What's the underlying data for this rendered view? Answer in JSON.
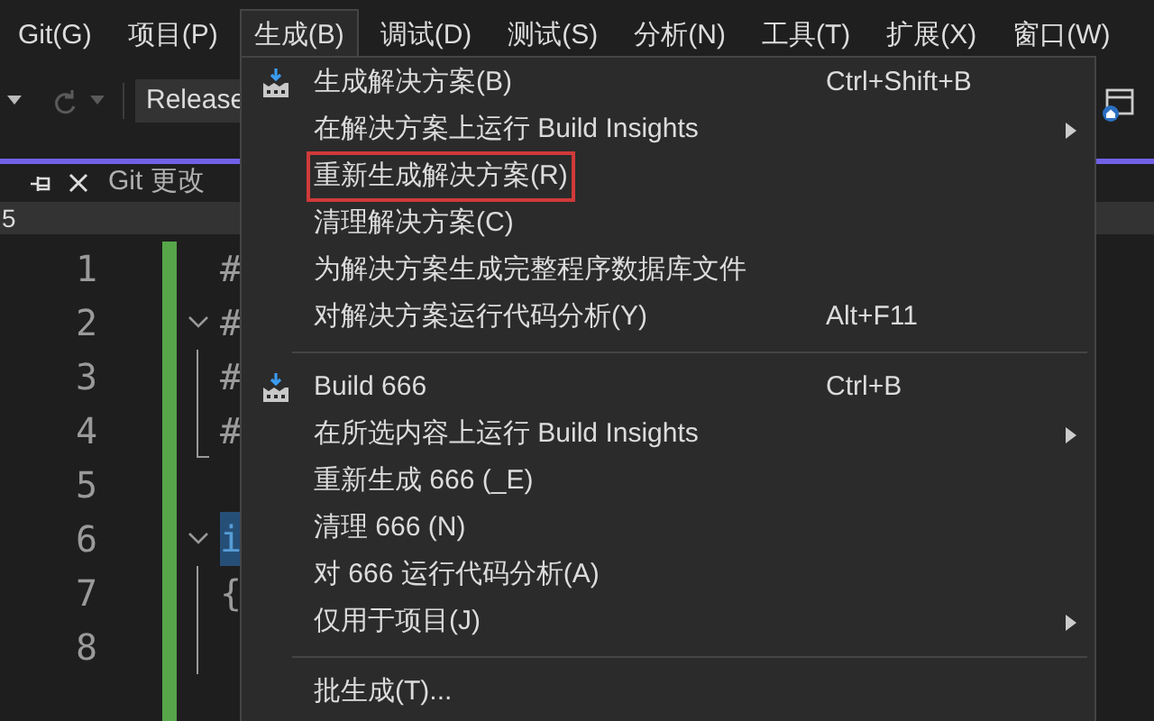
{
  "menu_bar": [
    {
      "label": "Git(G)",
      "selected": false
    },
    {
      "label": "项目(P)",
      "selected": false
    },
    {
      "label": "生成(B)",
      "selected": true
    },
    {
      "label": "调试(D)",
      "selected": false
    },
    {
      "label": "测试(S)",
      "selected": false
    },
    {
      "label": "分析(N)",
      "selected": false
    },
    {
      "label": "工具(T)",
      "selected": false
    },
    {
      "label": "扩展(X)",
      "selected": false
    },
    {
      "label": "窗口(W)",
      "selected": false
    }
  ],
  "toolbar": {
    "configuration": "Release"
  },
  "tab_strip": {
    "tab": "Git 更改"
  },
  "breadcrumb": "5",
  "editor": {
    "lines": [
      {
        "number": "1",
        "code": "#",
        "kind": "plain"
      },
      {
        "number": "2",
        "code": "#",
        "kind": "foldopen"
      },
      {
        "number": "3",
        "code": "#",
        "kind": "guide"
      },
      {
        "number": "4",
        "code": "#",
        "kind": "guideend"
      },
      {
        "number": "5",
        "kind": "plain"
      },
      {
        "number": "6",
        "code": "i",
        "kind": "foldopen"
      },
      {
        "number": "7",
        "code": "{",
        "kind": "guide"
      },
      {
        "number": "8",
        "kind": "guide"
      }
    ]
  },
  "build_menu": {
    "items": [
      {
        "kind": "item",
        "label": "生成解决方案(B)",
        "shortcut": "Ctrl+Shift+B",
        "icon": true,
        "submenu": false,
        "outlined": false
      },
      {
        "kind": "item",
        "label": "在解决方案上运行 Build Insights",
        "submenu": true,
        "icon": false,
        "outlined": false
      },
      {
        "kind": "item",
        "label": "重新生成解决方案(R)",
        "submenu": false,
        "icon": false,
        "outlined": true
      },
      {
        "kind": "item",
        "label": "清理解决方案(C)",
        "submenu": false,
        "icon": false,
        "outlined": false
      },
      {
        "kind": "item",
        "label": "为解决方案生成完整程序数据库文件",
        "submenu": false,
        "icon": false,
        "outlined": false
      },
      {
        "kind": "item",
        "label": "对解决方案运行代码分析(Y)",
        "shortcut": "Alt+F11",
        "submenu": false,
        "icon": false,
        "outlined": false
      },
      {
        "kind": "separator"
      },
      {
        "kind": "item",
        "label": "Build 666",
        "shortcut": "Ctrl+B",
        "icon": true,
        "submenu": false,
        "outlined": false
      },
      {
        "kind": "item",
        "label": "在所选内容上运行 Build Insights",
        "submenu": true,
        "icon": false,
        "outlined": false
      },
      {
        "kind": "item",
        "label": "重新生成 666 (_E)",
        "submenu": false,
        "icon": false,
        "outlined": false
      },
      {
        "kind": "item",
        "label": "清理 666 (N)",
        "submenu": false,
        "icon": false,
        "outlined": false
      },
      {
        "kind": "item",
        "label": "对 666 运行代码分析(A)",
        "submenu": false,
        "icon": false,
        "outlined": false
      },
      {
        "kind": "item",
        "label": "仅用于项目(J)",
        "submenu": true,
        "icon": false,
        "outlined": false
      },
      {
        "kind": "separator"
      },
      {
        "kind": "item",
        "label": "批生成(T)...",
        "submenu": false,
        "icon": false,
        "outlined": false
      }
    ]
  }
}
